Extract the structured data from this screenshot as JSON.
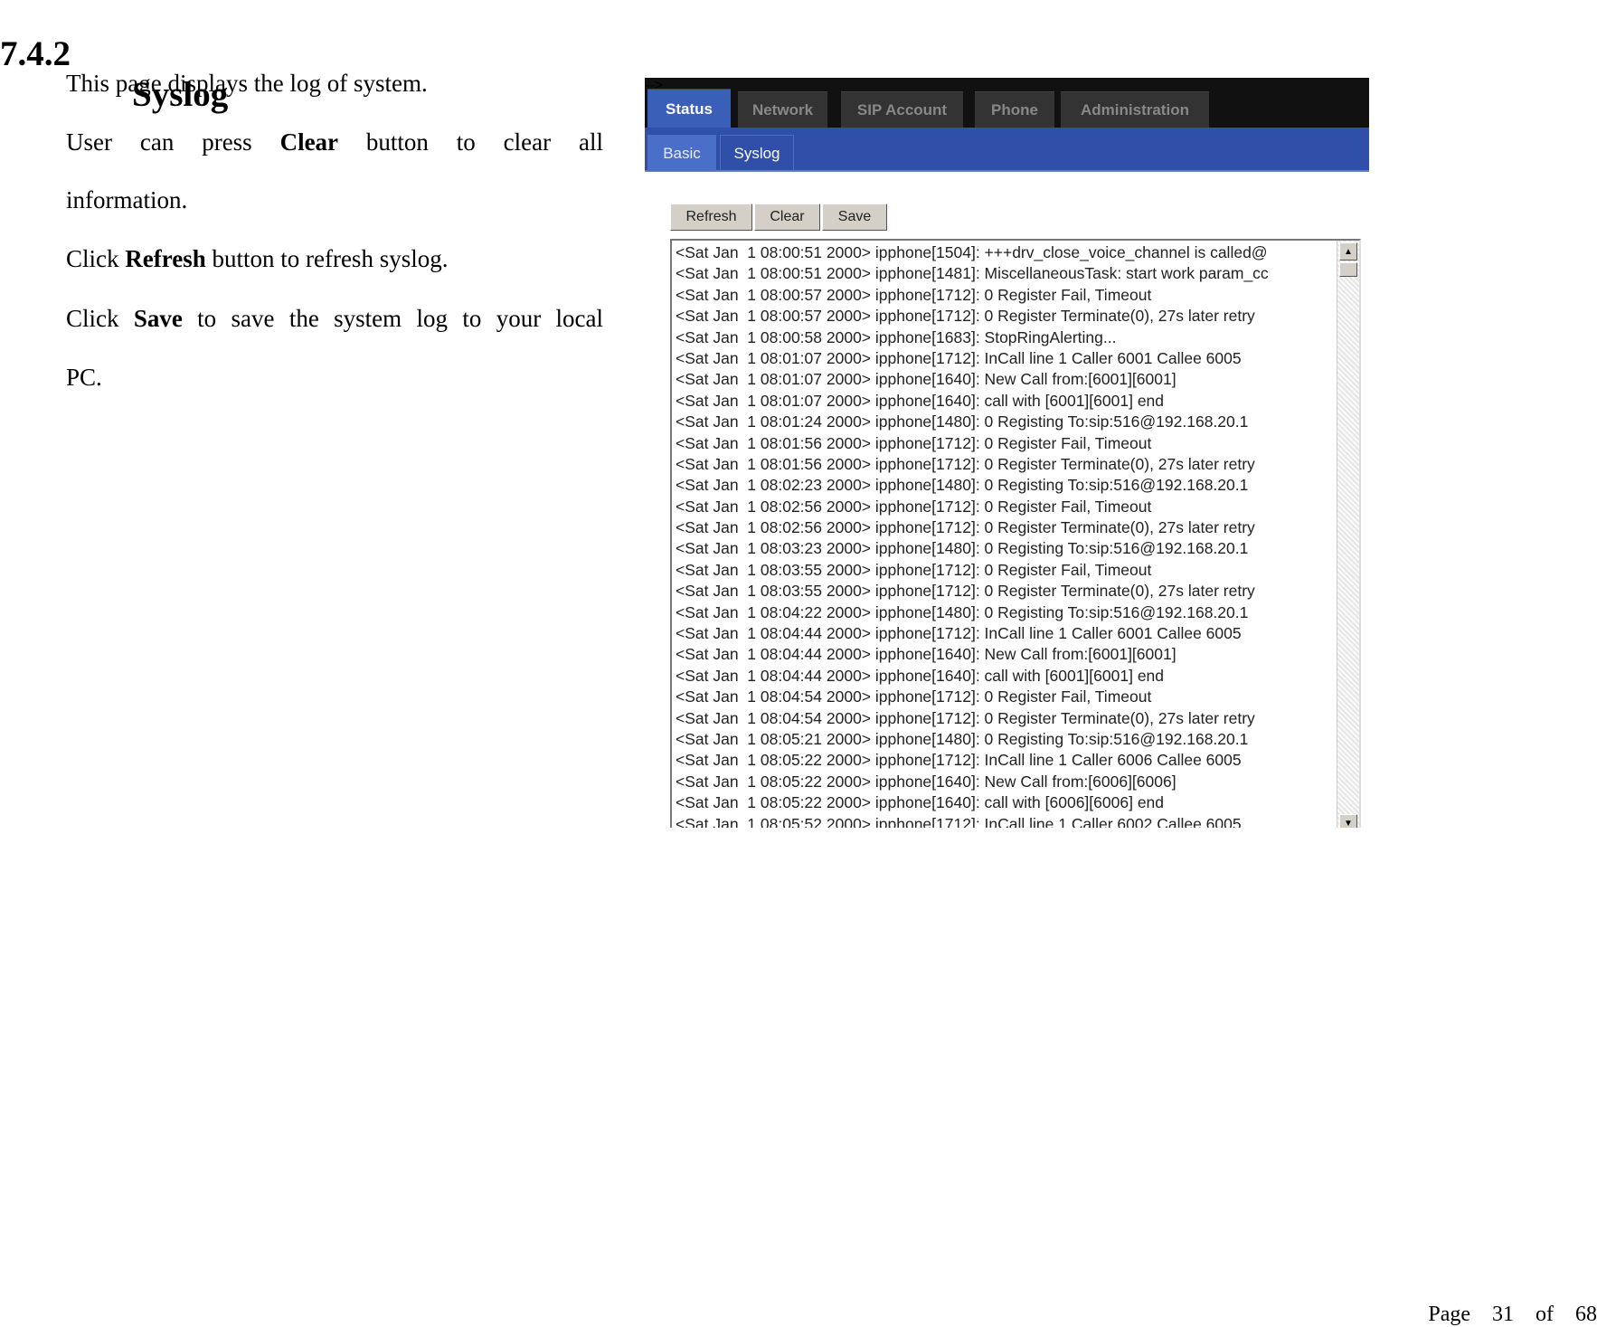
{
  "heading": {
    "number": "7.4.2",
    "title": "Syslog"
  },
  "paragraphs": {
    "p1": "This page displays the log of system.",
    "p2_a": "User can press ",
    "p2_bold": "Clear",
    "p2_b": " button to clear all",
    "p2_c": "information.",
    "p3_a": "Click ",
    "p3_bold": "Refresh",
    "p3_b": " button to refresh syslog.",
    "p4_a": "Click ",
    "p4_bold": "Save",
    "p4_b": " to save the system log to your local",
    "p4_c": "PC."
  },
  "screenshot": {
    "tabs": [
      "Status",
      "Network",
      "SIP Account",
      "Phone",
      "Administration"
    ],
    "active_tab": "Status",
    "subtabs": [
      "Basic",
      "Syslog"
    ],
    "active_subtab": "Basic",
    "buttons": {
      "refresh": "Refresh",
      "clear": "Clear",
      "save": "Save"
    },
    "colors": {
      "topbar": "#111111",
      "active_tab": "#3a5fb8",
      "subbar": "#2f4fa8"
    },
    "log_lines": [
      "<Sat Jan  1 08:00:51 2000> ipphone[1504]: +++drv_close_voice_channel is called@",
      "<Sat Jan  1 08:00:51 2000> ipphone[1481]: MiscellaneousTask: start work param_cc",
      "<Sat Jan  1 08:00:57 2000> ipphone[1712]: 0 Register Fail, Timeout",
      "<Sat Jan  1 08:00:57 2000> ipphone[1712]: 0 Register Terminate(0), 27s later retry",
      "<Sat Jan  1 08:00:58 2000> ipphone[1683]: StopRingAlerting...",
      "<Sat Jan  1 08:01:07 2000> ipphone[1712]: InCall line 1 Caller 6001 Callee 6005",
      "<Sat Jan  1 08:01:07 2000> ipphone[1640]: New Call from:[6001][6001]",
      "<Sat Jan  1 08:01:07 2000> ipphone[1640]: call with [6001][6001] end",
      "<Sat Jan  1 08:01:24 2000> ipphone[1480]: 0 Registing To:sip:516@192.168.20.1",
      "<Sat Jan  1 08:01:56 2000> ipphone[1712]: 0 Register Fail, Timeout",
      "<Sat Jan  1 08:01:56 2000> ipphone[1712]: 0 Register Terminate(0), 27s later retry",
      "<Sat Jan  1 08:02:23 2000> ipphone[1480]: 0 Registing To:sip:516@192.168.20.1",
      "<Sat Jan  1 08:02:56 2000> ipphone[1712]: 0 Register Fail, Timeout",
      "<Sat Jan  1 08:02:56 2000> ipphone[1712]: 0 Register Terminate(0), 27s later retry",
      "<Sat Jan  1 08:03:23 2000> ipphone[1480]: 0 Registing To:sip:516@192.168.20.1",
      "<Sat Jan  1 08:03:55 2000> ipphone[1712]: 0 Register Fail, Timeout",
      "<Sat Jan  1 08:03:55 2000> ipphone[1712]: 0 Register Terminate(0), 27s later retry",
      "<Sat Jan  1 08:04:22 2000> ipphone[1480]: 0 Registing To:sip:516@192.168.20.1",
      "<Sat Jan  1 08:04:44 2000> ipphone[1712]: InCall line 1 Caller 6001 Callee 6005",
      "<Sat Jan  1 08:04:44 2000> ipphone[1640]: New Call from:[6001][6001]",
      "<Sat Jan  1 08:04:44 2000> ipphone[1640]: call with [6001][6001] end",
      "<Sat Jan  1 08:04:54 2000> ipphone[1712]: 0 Register Fail, Timeout",
      "<Sat Jan  1 08:04:54 2000> ipphone[1712]: 0 Register Terminate(0), 27s later retry",
      "<Sat Jan  1 08:05:21 2000> ipphone[1480]: 0 Registing To:sip:516@192.168.20.1",
      "<Sat Jan  1 08:05:22 2000> ipphone[1712]: InCall line 1 Caller 6006 Callee 6005",
      "<Sat Jan  1 08:05:22 2000> ipphone[1640]: New Call from:[6006][6006]",
      "<Sat Jan  1 08:05:22 2000> ipphone[1640]: call with [6006][6006] end",
      "<Sat Jan  1 08:05:52 2000> ipphone[1712]: InCall line 1 Caller 6002 Callee 6005"
    ]
  },
  "footer": {
    "page": "Page  31  of  68"
  }
}
